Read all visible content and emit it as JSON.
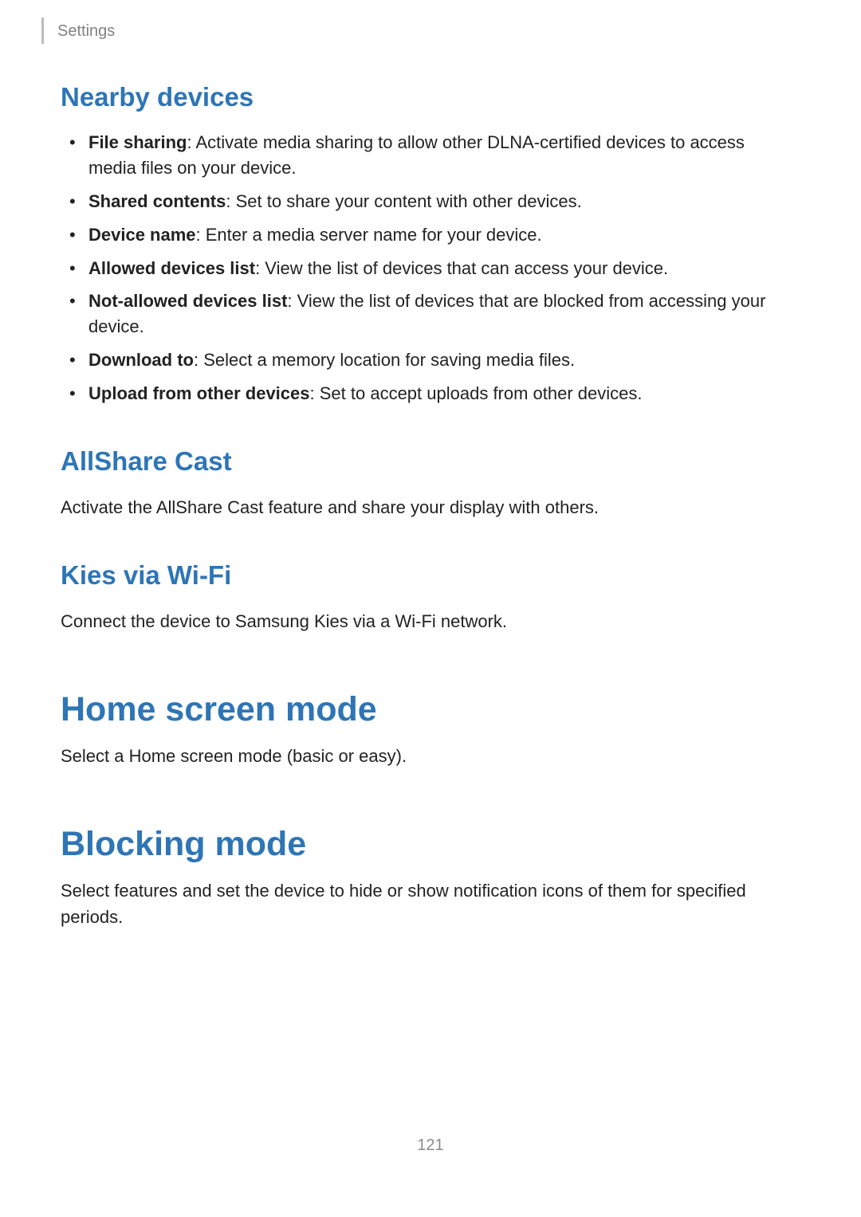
{
  "breadcrumb": "Settings",
  "sections": {
    "nearby_devices": {
      "title": "Nearby devices",
      "items": [
        {
          "label": "File sharing",
          "desc": ": Activate media sharing to allow other DLNA-certified devices to access media files on your device."
        },
        {
          "label": "Shared contents",
          "desc": ": Set to share your content with other devices."
        },
        {
          "label": "Device name",
          "desc": ": Enter a media server name for your device."
        },
        {
          "label": "Allowed devices list",
          "desc": ": View the list of devices that can access your device."
        },
        {
          "label": "Not-allowed devices list",
          "desc": ": View the list of devices that are blocked from accessing your device."
        },
        {
          "label": "Download to",
          "desc": ": Select a memory location for saving media files."
        },
        {
          "label": "Upload from other devices",
          "desc": ": Set to accept uploads from other devices."
        }
      ]
    },
    "allshare_cast": {
      "title": "AllShare Cast",
      "body": "Activate the AllShare Cast feature and share your display with others."
    },
    "kies": {
      "title": "Kies via Wi-Fi",
      "body": "Connect the device to Samsung Kies via a Wi-Fi network."
    },
    "home_screen": {
      "title": "Home screen mode",
      "body": "Select a Home screen mode (basic or easy)."
    },
    "blocking_mode": {
      "title": "Blocking mode",
      "body": "Select features and set the device to hide or show notification icons of them for specified periods."
    }
  },
  "page_number": "121"
}
